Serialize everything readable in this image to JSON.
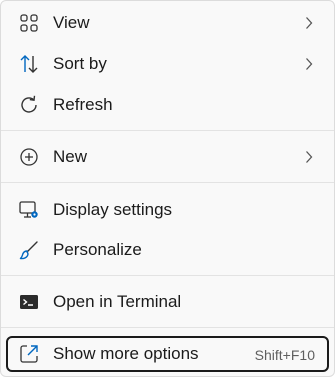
{
  "menu": {
    "items": [
      {
        "label": "View",
        "icon": "grid-icon",
        "submenu": true
      },
      {
        "label": "Sort by",
        "icon": "sort-arrows-icon",
        "submenu": true
      },
      {
        "label": "Refresh",
        "icon": "refresh-icon",
        "submenu": false
      },
      {
        "label": "New",
        "icon": "plus-circle-icon",
        "submenu": true
      },
      {
        "label": "Display settings",
        "icon": "display-settings-icon",
        "submenu": false
      },
      {
        "label": "Personalize",
        "icon": "brush-icon",
        "submenu": false
      },
      {
        "label": "Open in Terminal",
        "icon": "terminal-icon",
        "submenu": false
      },
      {
        "label": "Show more options",
        "icon": "open-external-icon",
        "shortcut": "Shift+F10",
        "focused": true
      }
    ]
  },
  "colors": {
    "accent": "#0067c0",
    "text": "#1b1b1b",
    "background": "#f9f9f9"
  }
}
